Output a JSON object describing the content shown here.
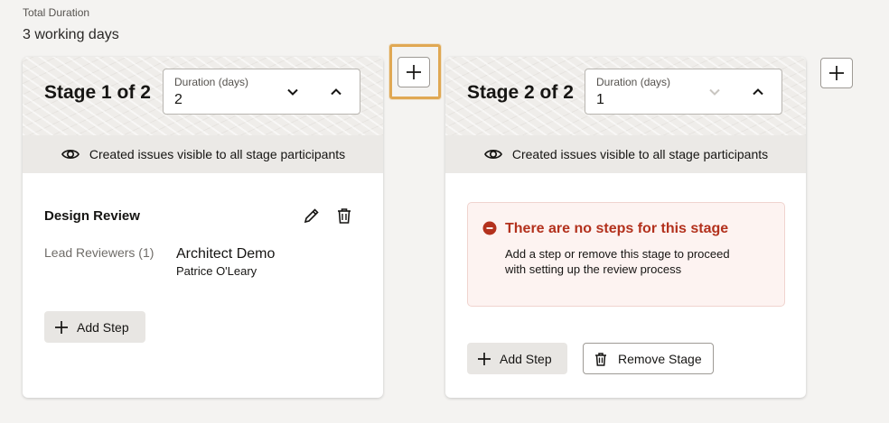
{
  "total_duration": {
    "label": "Total Duration",
    "value": "3 working days"
  },
  "stages": [
    {
      "title": "Stage 1 of 2",
      "duration_label": "Duration (days)",
      "duration_value": "2",
      "visibility_text": "Created issues visible to all stage participants",
      "step": {
        "title": "Design Review",
        "role_label": "Lead Reviewers (1)",
        "reviewer_name": "Architect Demo",
        "reviewer_sub": "Patrice O'Leary"
      },
      "add_step_label": "Add Step"
    },
    {
      "title": "Stage 2 of 2",
      "duration_label": "Duration (days)",
      "duration_value": "1",
      "visibility_text": "Created issues visible to all stage participants",
      "error": {
        "title": "There are no steps for this stage",
        "message": "Add a step or remove this stage to proceed with setting up the review process"
      },
      "add_step_label": "Add Step",
      "remove_stage_label": "Remove Stage"
    }
  ],
  "icons": {
    "eye": "eye-icon",
    "edit": "pencil-icon",
    "delete": "trash-icon",
    "error": "error-icon",
    "add": "plus-icon",
    "spin_up": "chevron-up-icon",
    "spin_down": "chevron-down-icon"
  },
  "colors": {
    "error_text": "#b3311d",
    "focus_ring": "#e0a853",
    "background": "#f4f3f1"
  }
}
